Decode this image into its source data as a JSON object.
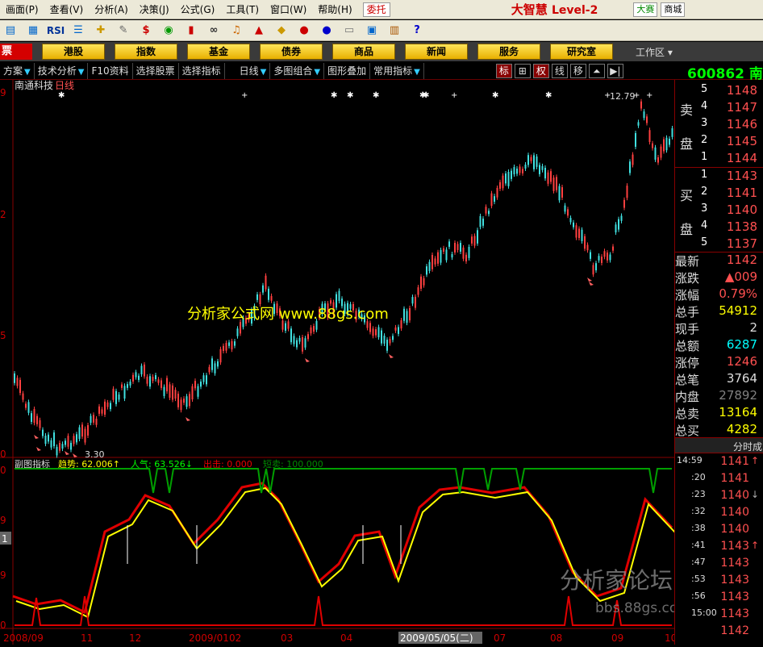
{
  "menu": {
    "items": [
      "画面(P)",
      "查看(V)",
      "分析(A)",
      "决策(J)",
      "公式(G)",
      "工具(T)",
      "窗口(W)",
      "帮助(H)"
    ],
    "entrust": "委托",
    "brand": "大智慧",
    "level": "Level-2",
    "tag1": "大赛",
    "tag2": "商城"
  },
  "toolbar": {
    "rsi": "RSI"
  },
  "nav": {
    "first": "票",
    "buttons": [
      "港股",
      "指数",
      "基金",
      "债券",
      "商品",
      "新闻",
      "服务",
      "研究室"
    ],
    "workspace": "工作区"
  },
  "subbar": {
    "items": [
      "方案",
      "技术分析",
      "F10资料",
      "选择股票",
      "选择指标",
      "日线",
      "多图组合",
      "图形叠加",
      "常用指标"
    ],
    "right": [
      "标",
      "⊞",
      "权",
      "线",
      "移",
      "",
      "▶|"
    ]
  },
  "stock": {
    "code": "600862",
    "name_suffix": "南",
    "title": "南通科技",
    "period": "日线"
  },
  "main_chart": {
    "y_ticks": [
      "9",
      "2",
      "5",
      "0"
    ],
    "high_label": "12.79",
    "low_label": "3.30"
  },
  "watermark": {
    "main": "分析家公式网 www.88gs.com",
    "forum": "分析家论坛",
    "forum_url": "bbs.88gs.com"
  },
  "sub_chart": {
    "title": "副图指标",
    "trend_label": "趋势: 62.006↑",
    "popularity_label": "人气: 63.526↓",
    "exit_label": "出击: 0.000",
    "short_label": "短卖: 100.000",
    "y_ticks": [
      "0",
      "9",
      "1",
      "9",
      "0"
    ]
  },
  "x_axis": {
    "labels": [
      "2008/09",
      "11",
      "12",
      "2009/01",
      "02",
      "03",
      "04",
      "2009/05/05(二)",
      "07",
      "08",
      "09",
      "10"
    ]
  },
  "orderbook": {
    "sell_label_1": "卖",
    "sell_label_2": "盘",
    "buy_label_1": "买",
    "buy_label_2": "盘",
    "sell": [
      {
        "level": "5",
        "price": "1148"
      },
      {
        "level": "4",
        "price": "1147"
      },
      {
        "level": "3",
        "price": "1146"
      },
      {
        "level": "2",
        "price": "1145"
      },
      {
        "level": "1",
        "price": "1144"
      }
    ],
    "buy": [
      {
        "level": "1",
        "price": "1143"
      },
      {
        "level": "2",
        "price": "1141"
      },
      {
        "level": "3",
        "price": "1140"
      },
      {
        "level": "4",
        "price": "1138"
      },
      {
        "level": "5",
        "price": "1137"
      }
    ]
  },
  "stats": [
    {
      "label": "最新",
      "value": "1142",
      "color": "#ff5050"
    },
    {
      "label": "涨跌",
      "value": "▲009",
      "color": "#ff5050"
    },
    {
      "label": "涨幅",
      "value": "0.79%",
      "color": "#ff5050"
    },
    {
      "label": "总手",
      "value": "54912",
      "color": "#ffff00"
    },
    {
      "label": "现手",
      "value": "2",
      "color": "#dddddd"
    },
    {
      "label": "总额",
      "value": "6287",
      "color": "#00ffff"
    },
    {
      "label": "涨停",
      "value": "1246",
      "color": "#ff5050"
    },
    {
      "label": "总笔",
      "value": "3764",
      "color": "#dddddd"
    },
    {
      "label": "内盘",
      "value": "27892",
      "color": "#808080"
    },
    {
      "label": "总卖",
      "value": "13164",
      "color": "#ffff00"
    },
    {
      "label": "总买",
      "value": "4282",
      "color": "#ffff00"
    }
  ],
  "ticks": {
    "header": "分时成",
    "rows": [
      {
        "time": "14:59",
        "price": "1141",
        "arrow": "↑"
      },
      {
        "time": ":20",
        "price": "1141",
        "arrow": ""
      },
      {
        "time": ":23",
        "price": "1140",
        "arrow": "↓"
      },
      {
        "time": ":32",
        "price": "1140",
        "arrow": ""
      },
      {
        "time": ":38",
        "price": "1140",
        "arrow": ""
      },
      {
        "time": ":41",
        "price": "1143",
        "arrow": "↑"
      },
      {
        "time": ":47",
        "price": "1143",
        "arrow": ""
      },
      {
        "time": ":53",
        "price": "1143",
        "arrow": ""
      },
      {
        "time": ":56",
        "price": "1143",
        "arrow": ""
      },
      {
        "time": "15:00",
        "price": "1143",
        "arrow": ""
      },
      {
        "time": "",
        "price": "1142",
        "arrow": ""
      }
    ]
  },
  "colors": {
    "up": "#ff4040",
    "down": "#40e0e0",
    "line_red": "#e00000",
    "line_yellow": "#ffff00",
    "line_green": "#00a000"
  }
}
